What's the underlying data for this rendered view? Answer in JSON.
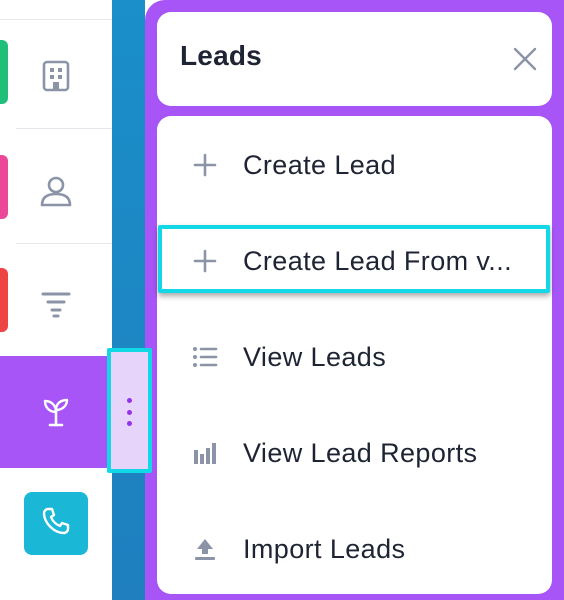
{
  "sidebar": {
    "items": [
      {
        "icon": "building-icon",
        "accent": "#1fbf7a"
      },
      {
        "icon": "user-icon",
        "accent": "#ec4899"
      },
      {
        "icon": "funnel-icon",
        "accent": "#ef4444"
      },
      {
        "icon": "sprout-icon",
        "active": true
      },
      {
        "icon": "phone-icon",
        "accent": "#1ab7d6"
      }
    ]
  },
  "panel": {
    "title": "Leads",
    "menu": [
      {
        "icon": "plus-icon",
        "label": "Create Lead"
      },
      {
        "icon": "plus-icon",
        "label": "Create Lead From v..."
      },
      {
        "icon": "list-icon",
        "label": "View Leads"
      },
      {
        "icon": "bar-chart-icon",
        "label": "View Lead Reports"
      },
      {
        "icon": "upload-icon",
        "label": "Import Leads"
      }
    ]
  },
  "colors": {
    "panel_bg": "#a855f7",
    "highlight_border": "#12d8e6",
    "icon_gray": "#8a94a6"
  }
}
